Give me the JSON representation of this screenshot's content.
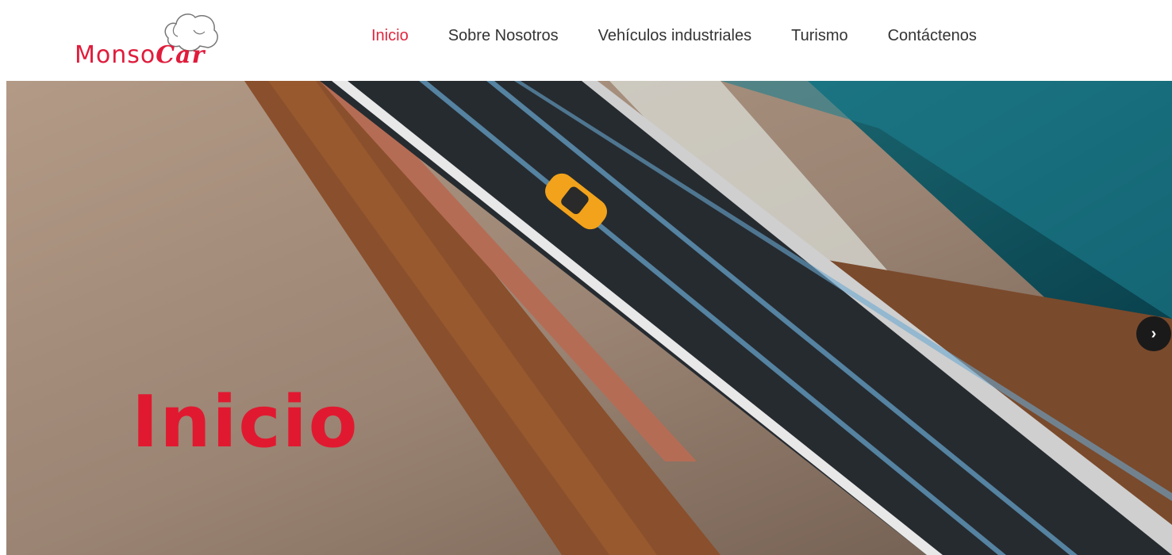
{
  "logo": {
    "text_main": "Monso",
    "text_script": "Car"
  },
  "nav": {
    "items": [
      {
        "label": "Inicio",
        "active": true
      },
      {
        "label": "Sobre Nosotros",
        "active": false
      },
      {
        "label": "Vehículos industriales",
        "active": false
      },
      {
        "label": "Turismo",
        "active": false
      },
      {
        "label": "Contáctenos",
        "active": false
      }
    ]
  },
  "hero": {
    "title": "Inicio",
    "next_icon": "chevron-right-icon",
    "next_glyph": "›"
  },
  "colors": {
    "brand": "#e0263d",
    "nav_text": "#333333"
  }
}
